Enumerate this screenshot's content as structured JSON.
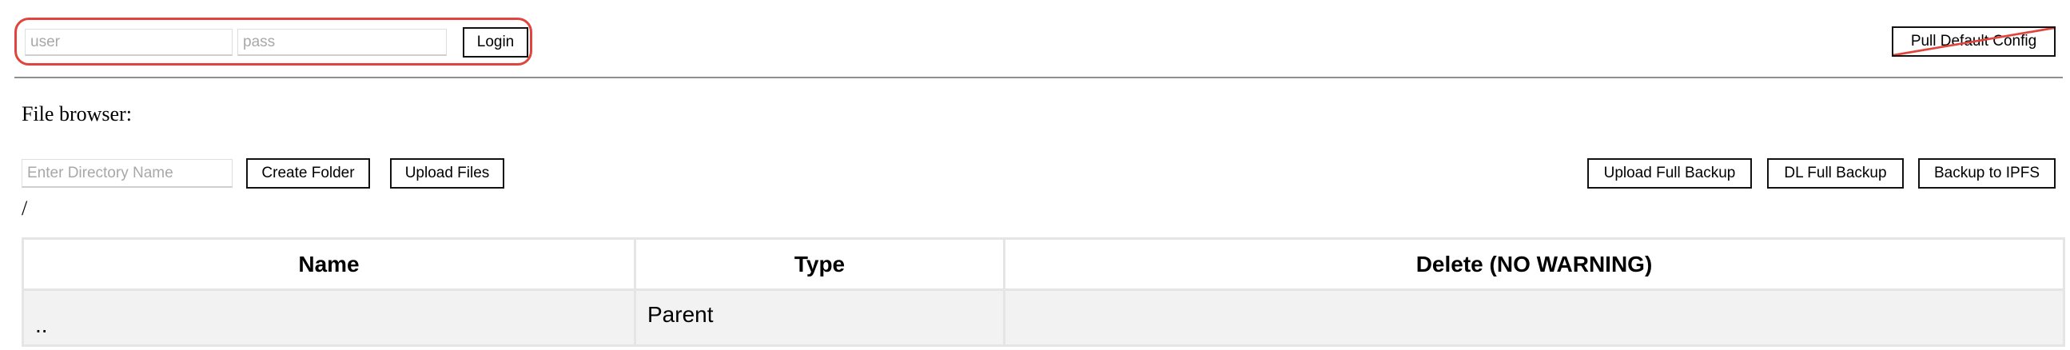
{
  "login": {
    "user_placeholder": "user",
    "pass_placeholder": "pass",
    "login_label": "Login",
    "highlight_color": "#e0443c"
  },
  "header": {
    "pull_config_label": "Pull Default Config",
    "pull_config_strike_color": "#e0443c"
  },
  "file_browser": {
    "title": "File browser:",
    "dir_placeholder": "Enter Directory Name",
    "create_folder_label": "Create Folder",
    "upload_files_label": "Upload Files",
    "upload_backup_label": "Upload Full Backup",
    "dl_backup_label": "DL Full Backup",
    "ipfs_backup_label": "Backup to IPFS",
    "current_path": "/"
  },
  "table": {
    "columns": [
      "Name",
      "Type",
      "Delete (NO WARNING)"
    ],
    "rows": [
      {
        "name": "..",
        "type": "Parent",
        "delete": ""
      }
    ]
  }
}
